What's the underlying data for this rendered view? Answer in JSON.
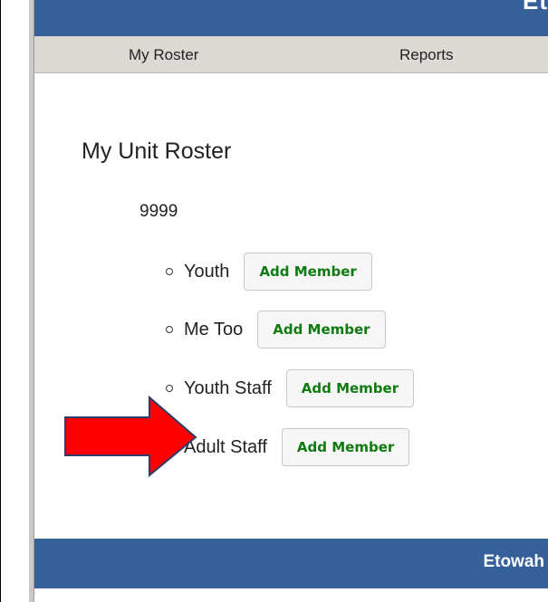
{
  "header": {
    "corner_text": "Et",
    "banner_color": "#35609a"
  },
  "nav": {
    "items": [
      {
        "label": "My Roster"
      },
      {
        "label": "Reports"
      }
    ]
  },
  "main": {
    "title": "My Unit Roster",
    "unit_number": "9999",
    "roster_groups": [
      {
        "label": "Youth",
        "button": "Add Member"
      },
      {
        "label": "Me Too",
        "button": "Add Member"
      },
      {
        "label": "Youth Staff",
        "button": "Add Member"
      },
      {
        "label": "Adult Staff",
        "button": "Add Member"
      }
    ]
  },
  "footer": {
    "text": "Etowah"
  },
  "annotation": {
    "icon": "red-arrow-icon",
    "color": "#ff0000"
  },
  "colors": {
    "accent": "#35609a",
    "button_text": "#0f7a0f",
    "nav_bg": "#dcd8d3"
  }
}
